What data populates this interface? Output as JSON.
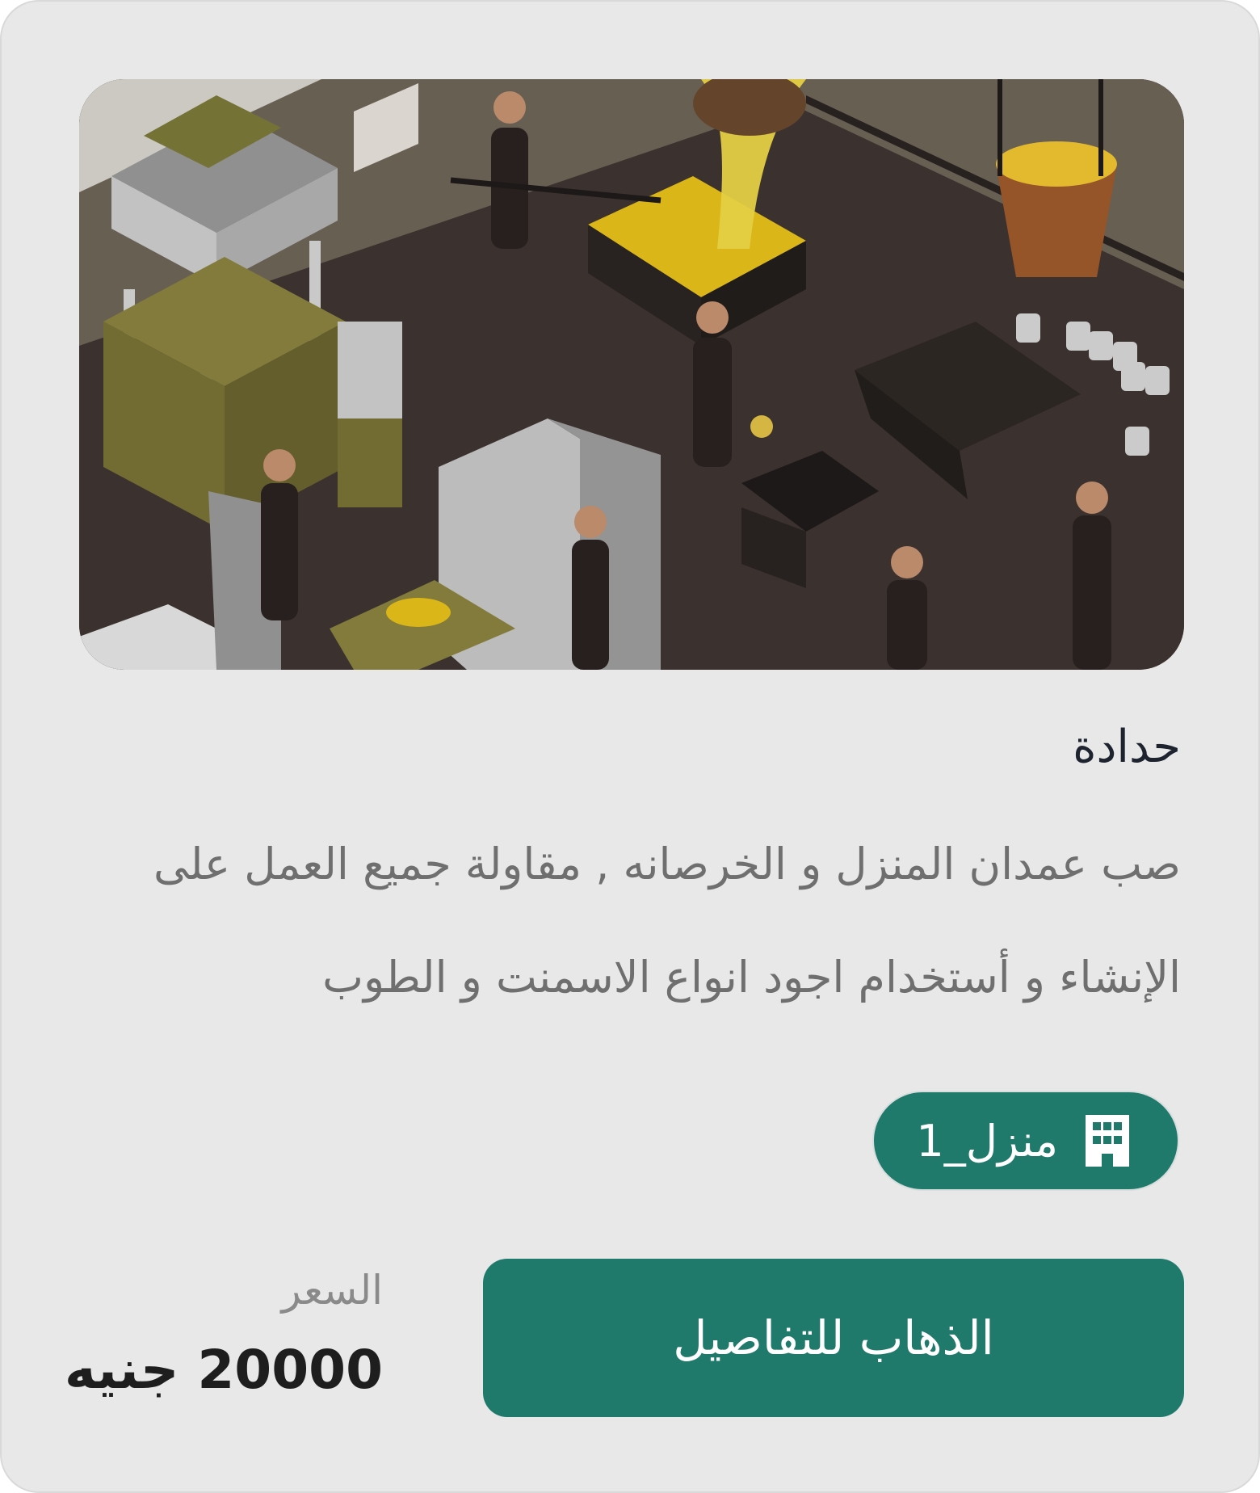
{
  "card": {
    "title": "حدادة",
    "description": "صب عمدان المنزل و الخرصانه , مقاولة جميع العمل على الإنشاء و أستخدام اجود انواع الاسمنت و الطوب",
    "tag": {
      "icon": "building-icon",
      "label": "1_منزل"
    },
    "button_label": "الذهاب للتفاصيل",
    "price_label": "السعر",
    "price_value": "20000 جنيه"
  },
  "image": {
    "subject": "foundry-workers-illustration"
  },
  "colors": {
    "card_background": "#e8e8e8",
    "accent": "#1f7a6c",
    "title_text": "#1e2330",
    "body_text": "#6f6f6f",
    "muted_text": "#8a8a8a"
  }
}
